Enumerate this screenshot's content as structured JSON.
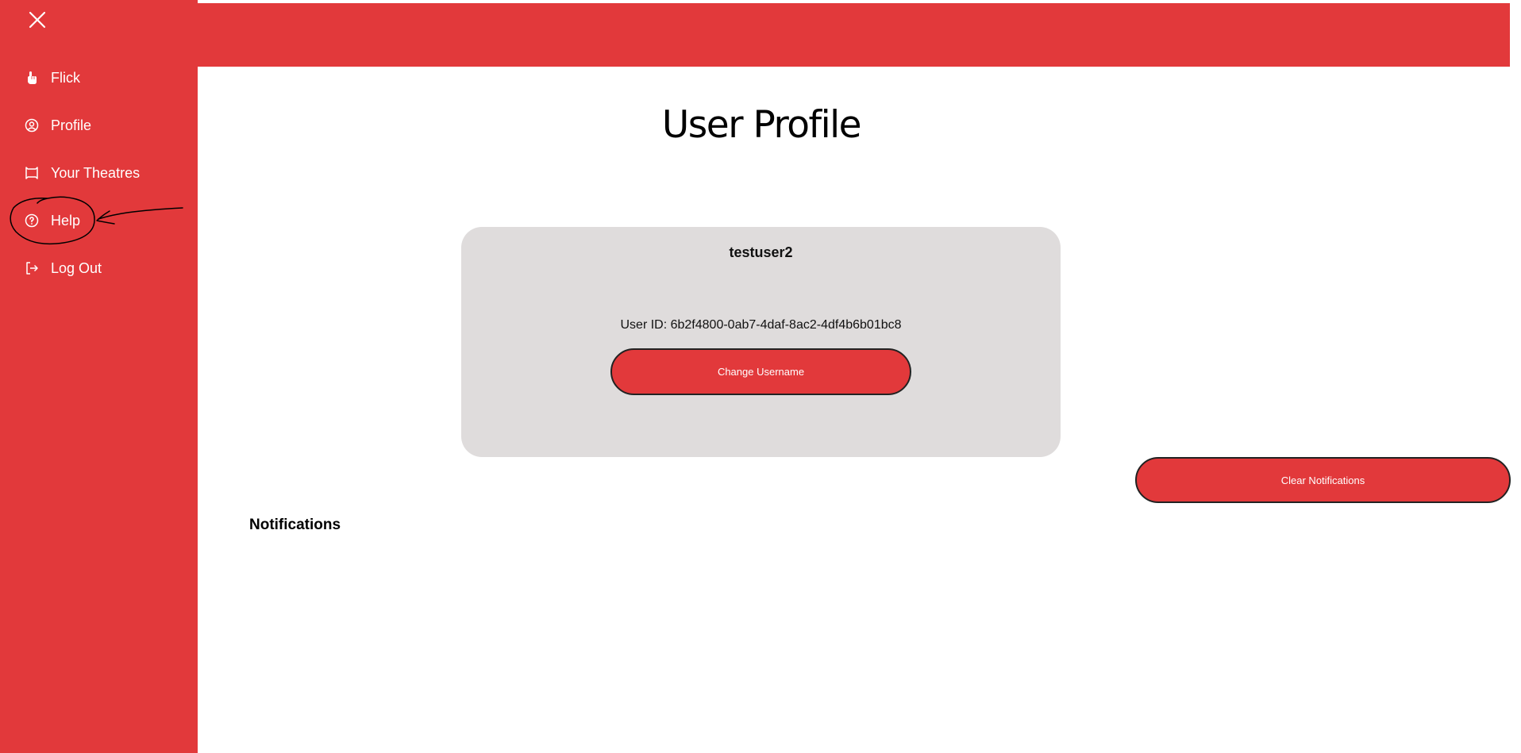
{
  "sidebar": {
    "close_icon": "close-icon",
    "items": [
      {
        "label": "Flick",
        "icon": "pointing-hand-icon"
      },
      {
        "label": "Profile",
        "icon": "user-circle-icon"
      },
      {
        "label": "Your Theatres",
        "icon": "theatre-screen-icon"
      },
      {
        "label": "Help",
        "icon": "help-circle-icon"
      },
      {
        "label": "Log Out",
        "icon": "logout-icon"
      }
    ]
  },
  "main": {
    "title": "User Profile",
    "profile_card": {
      "username": "testuser2",
      "user_id": "User ID: 6b2f4800-0ab7-4daf-8ac2-4df4b6b01bc8",
      "change_username_label": "Change Username"
    },
    "clear_notifications_label": "Clear Notifications",
    "notifications_title": "Notifications"
  },
  "colors": {
    "accent": "#e2393b",
    "card_bg": "#dfdcdc",
    "text_light": "#ffffff"
  }
}
